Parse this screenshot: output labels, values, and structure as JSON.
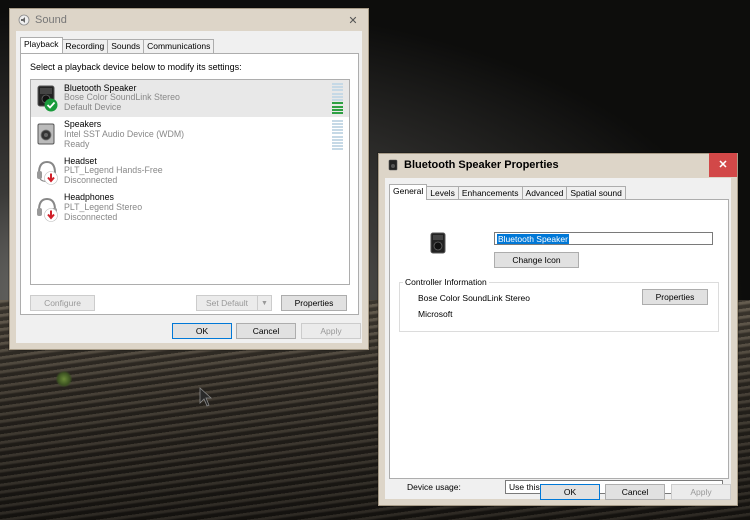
{
  "sound_window": {
    "title": "Sound",
    "close": "✕",
    "tabs": [
      "Playback",
      "Recording",
      "Sounds",
      "Communications"
    ],
    "instruction": "Select a playback device below to modify its settings:",
    "devices": [
      {
        "name": "Bluetooth Speaker",
        "desc": "Bose Color SoundLink Stereo",
        "status": "Default Device",
        "icon": "speaker-icon",
        "badge": "default-check-icon",
        "meter_level": 0.4
      },
      {
        "name": "Speakers",
        "desc": "Intel SST Audio Device (WDM)",
        "status": "Ready",
        "icon": "speaker-icon",
        "badge": "",
        "meter_level": 0
      },
      {
        "name": "Headset",
        "desc": "PLT_Legend Hands-Free",
        "status": "Disconnected",
        "icon": "headset-icon",
        "badge": "disconnected-arrow-icon"
      },
      {
        "name": "Headphones",
        "desc": "PLT_Legend Stereo",
        "status": "Disconnected",
        "icon": "headphones-icon",
        "badge": "disconnected-arrow-icon"
      }
    ],
    "buttons": {
      "configure": "Configure",
      "set_default": "Set Default",
      "properties": "Properties",
      "ok": "OK",
      "cancel": "Cancel",
      "apply": "Apply"
    }
  },
  "props_window": {
    "title": "Bluetooth Speaker Properties",
    "close": "✕",
    "tabs": [
      "General",
      "Levels",
      "Enhancements",
      "Advanced",
      "Spatial sound"
    ],
    "device_name": "Bluetooth Speaker",
    "change_icon": "Change Icon",
    "controller_info_label": "Controller Information",
    "controller_name": "Bose Color SoundLink Stereo",
    "controller_vendor": "Microsoft",
    "properties_button": "Properties",
    "device_usage_label": "Device usage:",
    "device_usage_value": "Use this device (enable)",
    "buttons": {
      "ok": "OK",
      "cancel": "Cancel",
      "apply": "Apply"
    }
  },
  "colors": {
    "accent": "#0078d7",
    "check_green": "#1a9b3c",
    "disconnect_red": "#d0202a",
    "close_red": "#d24848"
  }
}
